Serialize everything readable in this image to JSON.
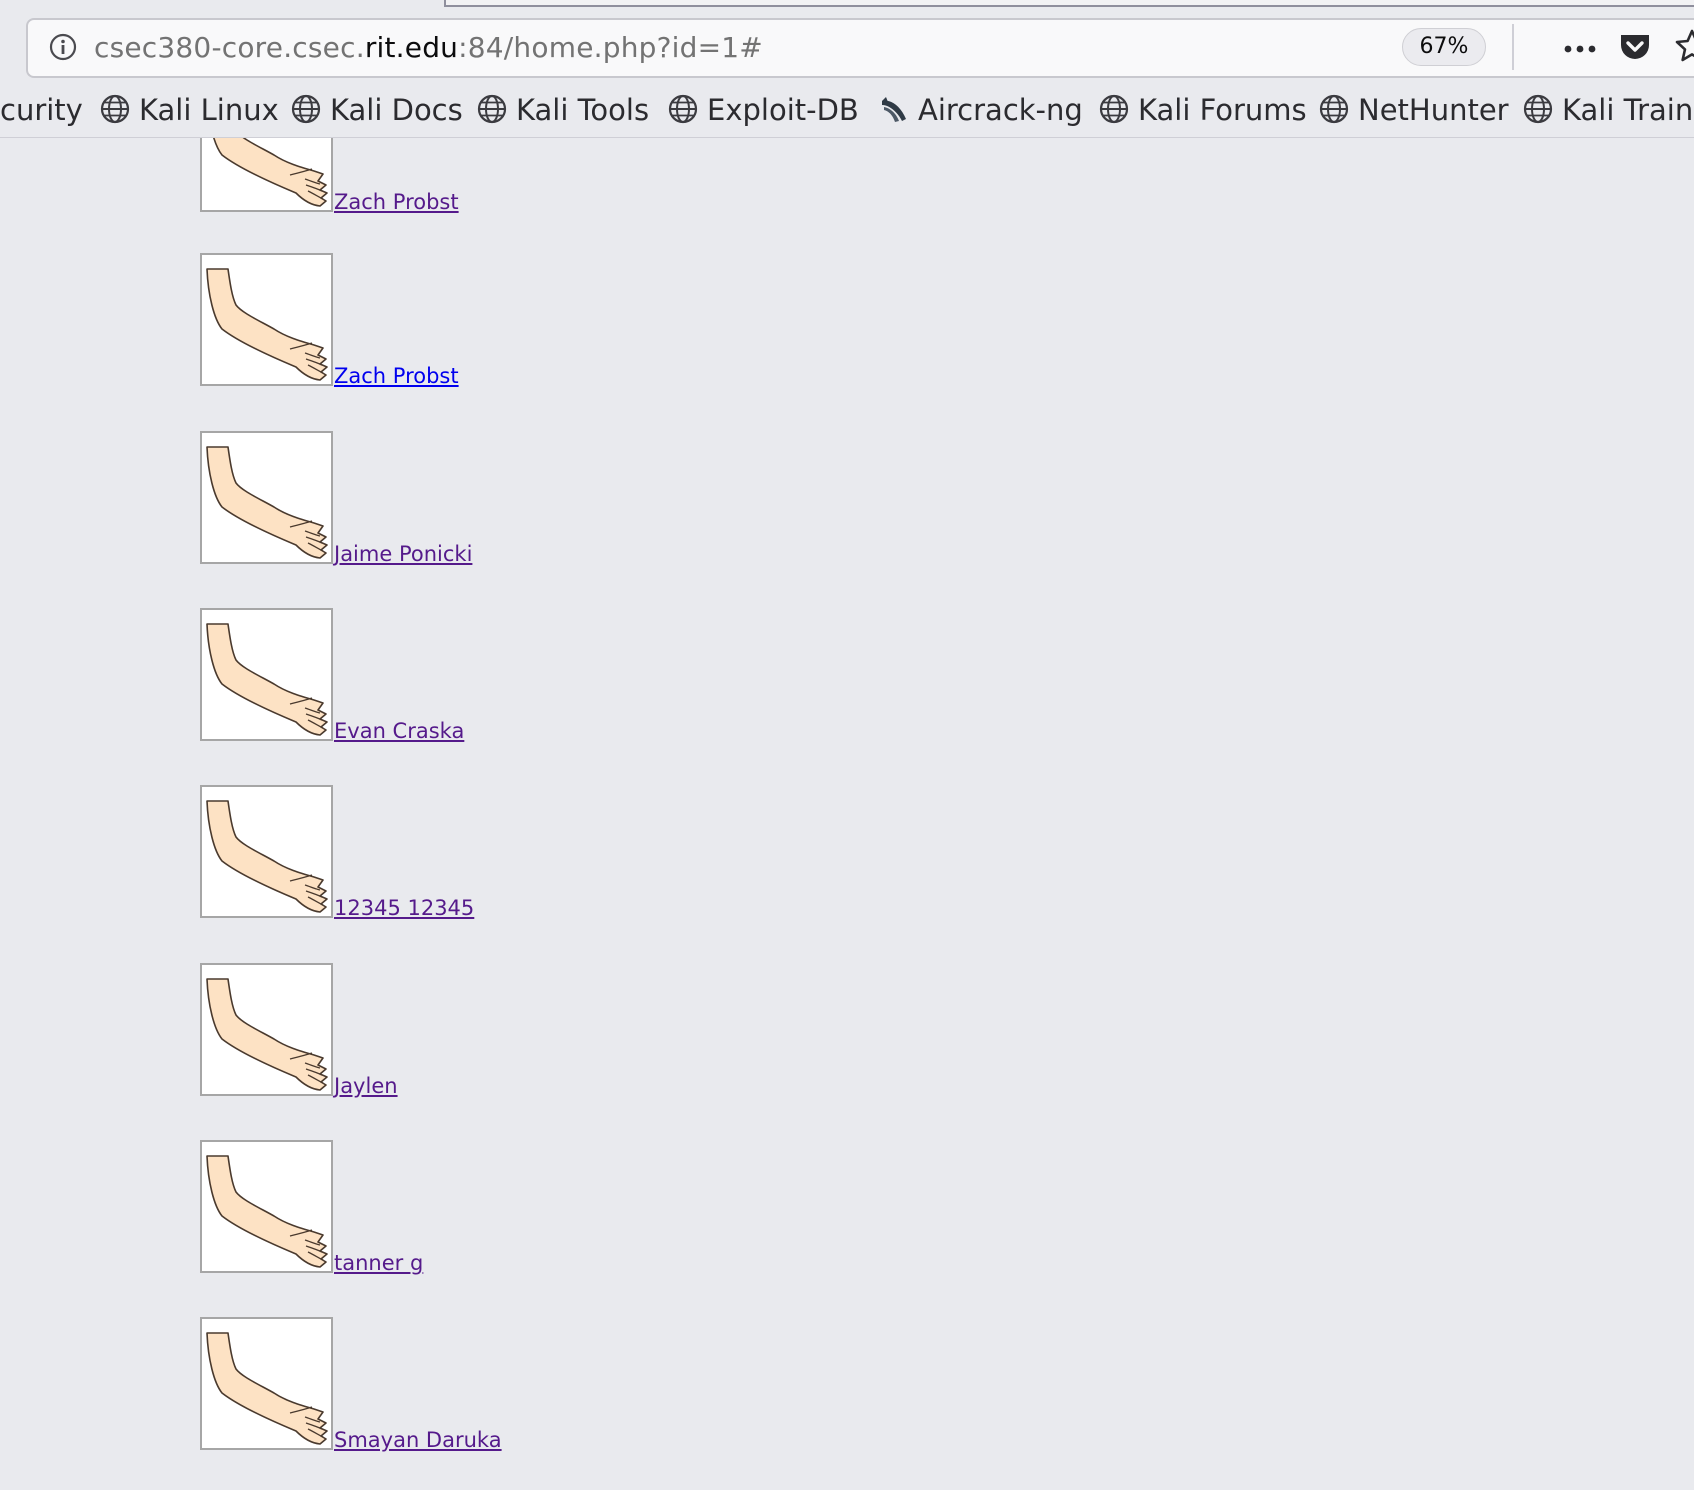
{
  "browser": {
    "url": {
      "prefix": "csec380-core.csec.",
      "domain": "rit.edu",
      "suffix": ":84/home.php?id=1#"
    },
    "zoom": "67%",
    "icons": {
      "info": "info-icon",
      "page_actions": "more-horizontal-icon",
      "pocket": "pocket-icon",
      "bookmark": "star-icon"
    }
  },
  "bookmarks": [
    {
      "label": "curity",
      "icon": "none"
    },
    {
      "label": "Kali Linux",
      "icon": "globe-icon"
    },
    {
      "label": "Kali Docs",
      "icon": "globe-icon"
    },
    {
      "label": "Kali Tools",
      "icon": "globe-icon"
    },
    {
      "label": "Exploit-DB",
      "icon": "globe-icon"
    },
    {
      "label": "Aircrack-ng",
      "icon": "aircrack-icon"
    },
    {
      "label": "Kali Forums",
      "icon": "globe-icon"
    },
    {
      "label": "NetHunter",
      "icon": "globe-icon"
    },
    {
      "label": "Kali Traini",
      "icon": "globe-icon"
    }
  ],
  "users": [
    {
      "name": "Zach Probst",
      "visited": true,
      "image": "arm-icon"
    },
    {
      "name": "Zach Probst",
      "visited": false,
      "image": "arm-icon"
    },
    {
      "name": "Jaime Ponicki",
      "visited": true,
      "image": "arm-icon"
    },
    {
      "name": "Evan Craska",
      "visited": true,
      "image": "arm-icon"
    },
    {
      "name": "12345 12345",
      "visited": true,
      "image": "arm-icon"
    },
    {
      "name": "Jaylen",
      "visited": true,
      "image": "arm-icon"
    },
    {
      "name": "tanner g",
      "visited": true,
      "image": "arm-icon"
    },
    {
      "name": "Smayan Daruka",
      "visited": true,
      "image": "arm-icon"
    }
  ],
  "colors": {
    "page_background": "#e9eaee",
    "visited_link": "#551a8b",
    "unvisited_link": "#0000ee",
    "skin": "#fde2c4"
  }
}
